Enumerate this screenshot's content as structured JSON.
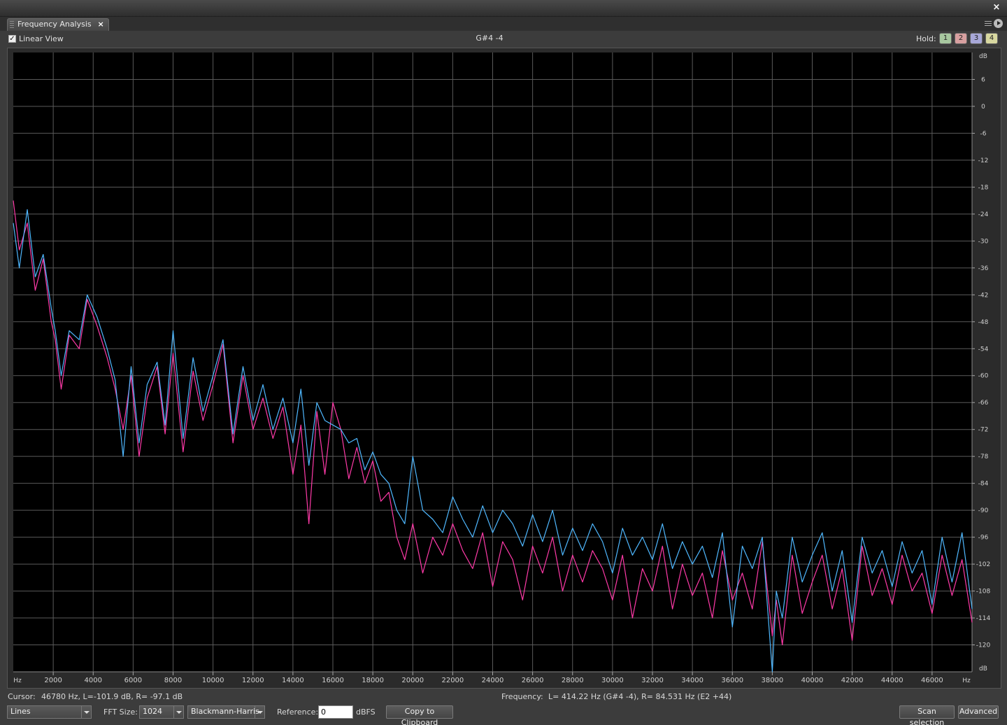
{
  "window": {
    "close_glyph": "×"
  },
  "tab": {
    "label": "Frequency Analysis",
    "close_glyph": "×"
  },
  "toolbar": {
    "linear_view_label": "Linear View",
    "linear_view_checked": true,
    "note": "G#4 -4",
    "hold_label": "Hold:",
    "hold_buttons": [
      {
        "label": "1",
        "color": "#a8c8a0"
      },
      {
        "label": "2",
        "color": "#d8a0a0"
      },
      {
        "label": "3",
        "color": "#a8a8d8"
      },
      {
        "label": "4",
        "color": "#d8d8a0"
      }
    ]
  },
  "status": {
    "cursor_label": "Cursor:",
    "cursor_value": "46780 Hz, L=-101.9 dB, R= -97.1 dB",
    "frequency_label": "Frequency:",
    "frequency_value": "L= 414.22 Hz (G#4 -4), R= 84.531 Hz (E2 +44)"
  },
  "controls": {
    "display_mode": "Lines",
    "fft_size_label": "FFT Size:",
    "fft_size": "1024",
    "window_function": "Blackmann-Harris",
    "reference_label": "Reference:",
    "reference_value": "0",
    "reference_unit": "dBFS",
    "copy_button": "Copy to Clipboard",
    "scan_button": "Scan selection",
    "advanced_button": "Advanced"
  },
  "chart_data": {
    "type": "line",
    "xlabel": "Hz",
    "ylabel": "dB",
    "xlim": [
      0,
      48000
    ],
    "ylim": [
      -126,
      12
    ],
    "x_ticks": [
      2000,
      4000,
      6000,
      8000,
      10000,
      12000,
      14000,
      16000,
      18000,
      20000,
      22000,
      24000,
      26000,
      28000,
      30000,
      32000,
      34000,
      36000,
      38000,
      40000,
      42000,
      44000,
      46000
    ],
    "y_ticks": [
      6,
      0,
      -6,
      -12,
      -18,
      -24,
      -30,
      -36,
      -42,
      -48,
      -54,
      -60,
      -66,
      -72,
      -78,
      -84,
      -90,
      -96,
      -102,
      -108,
      -114,
      -120
    ],
    "grid": true,
    "background": "#000000",
    "series": [
      {
        "color": "#ff3aa8",
        "x": [
          0,
          300,
          700,
          1100,
          1500,
          1900,
          2100,
          2400,
          2800,
          3300,
          3700,
          4200,
          4700,
          5100,
          5500,
          5900,
          6300,
          6700,
          7200,
          7600,
          8000,
          8500,
          9000,
          9500,
          10000,
          10500,
          11000,
          11500,
          12000,
          12500,
          13000,
          13500,
          14000,
          14400,
          14800,
          15200,
          15600,
          16000,
          16400,
          16800,
          17200,
          17600,
          18000,
          18400,
          18800,
          19200,
          19600,
          20000,
          20500,
          21000,
          21500,
          22000,
          22500,
          23000,
          23500,
          24000,
          24500,
          25000,
          25500,
          26000,
          26500,
          27000,
          27500,
          28000,
          28500,
          29000,
          29500,
          30000,
          30500,
          31000,
          31500,
          32000,
          32500,
          33000,
          33500,
          34000,
          34500,
          35000,
          35500,
          36000,
          36500,
          37000,
          37500,
          38000,
          38200,
          38500,
          39000,
          39500,
          40000,
          40500,
          41000,
          41500,
          42000,
          42500,
          43000,
          43500,
          44000,
          44500,
          45000,
          45500,
          46000,
          46500,
          47000,
          47500,
          48000
        ],
        "y": [
          -21,
          -32,
          -26,
          -41,
          -34,
          -48,
          -52,
          -63,
          -51,
          -54,
          -43,
          -49,
          -56,
          -63,
          -72,
          -60,
          -78,
          -65,
          -58,
          -73,
          -55,
          -77,
          -59,
          -70,
          -62,
          -53,
          -75,
          -60,
          -72,
          -65,
          -74,
          -67,
          -82,
          -71,
          -93,
          -68,
          -82,
          -66,
          -72,
          -83,
          -76,
          -84,
          -79,
          -88,
          -86,
          -96,
          -101,
          -93,
          -104,
          -96,
          -100,
          -93,
          -99,
          -103,
          -95,
          -107,
          -97,
          -101,
          -110,
          -98,
          -104,
          -96,
          -108,
          -100,
          -106,
          -99,
          -103,
          -110,
          -100,
          -114,
          -103,
          -108,
          -98,
          -112,
          -102,
          -109,
          -104,
          -114,
          -99,
          -110,
          -104,
          -112,
          -97,
          -118,
          -110,
          -120,
          -100,
          -113,
          -106,
          -100,
          -112,
          -103,
          -119,
          -98,
          -109,
          -103,
          -111,
          -100,
          -108,
          -104,
          -113,
          -100,
          -109,
          -101,
          -115
        ]
      },
      {
        "color": "#4fb8ff",
        "x": [
          0,
          300,
          700,
          1100,
          1500,
          1900,
          2100,
          2400,
          2800,
          3300,
          3700,
          4200,
          4700,
          5100,
          5500,
          5900,
          6300,
          6700,
          7200,
          7600,
          8000,
          8500,
          9000,
          9500,
          10000,
          10500,
          11000,
          11500,
          12000,
          12500,
          13000,
          13500,
          14000,
          14400,
          14800,
          15200,
          15600,
          16000,
          16400,
          16800,
          17200,
          17600,
          18000,
          18400,
          18800,
          19200,
          19600,
          20000,
          20500,
          21000,
          21500,
          22000,
          22500,
          23000,
          23500,
          24000,
          24500,
          25000,
          25500,
          26000,
          26500,
          27000,
          27500,
          28000,
          28500,
          29000,
          29500,
          30000,
          30500,
          31000,
          31500,
          32000,
          32500,
          33000,
          33500,
          34000,
          34500,
          35000,
          35500,
          36000,
          36500,
          37000,
          37500,
          38000,
          38200,
          38500,
          39000,
          39500,
          40000,
          40500,
          41000,
          41500,
          42000,
          42500,
          43000,
          43500,
          44000,
          44500,
          45000,
          45500,
          46000,
          46500,
          47000,
          47500,
          48000
        ],
        "y": [
          -26,
          -36,
          -23,
          -38,
          -33,
          -45,
          -50,
          -60,
          -50,
          -52,
          -42,
          -47,
          -54,
          -61,
          -78,
          -58,
          -75,
          -62,
          -57,
          -71,
          -50,
          -74,
          -56,
          -68,
          -60,
          -52,
          -73,
          -58,
          -70,
          -62,
          -72,
          -65,
          -75,
          -63,
          -80,
          -66,
          -70,
          -71,
          -72,
          -75,
          -74,
          -81,
          -77,
          -82,
          -84,
          -90,
          -93,
          -78,
          -90,
          -92,
          -95,
          -87,
          -92,
          -96,
          -89,
          -95,
          -90,
          -93,
          -98,
          -91,
          -97,
          -90,
          -100,
          -94,
          -99,
          -93,
          -97,
          -104,
          -94,
          -100,
          -96,
          -101,
          -93,
          -103,
          -97,
          -102,
          -98,
          -105,
          -95,
          -116,
          -98,
          -103,
          -96,
          -126,
          -108,
          -114,
          -96,
          -106,
          -100,
          -95,
          -108,
          -99,
          -115,
          -96,
          -104,
          -99,
          -107,
          -97,
          -104,
          -99,
          -111,
          -96,
          -106,
          -95,
          -112
        ]
      }
    ]
  }
}
